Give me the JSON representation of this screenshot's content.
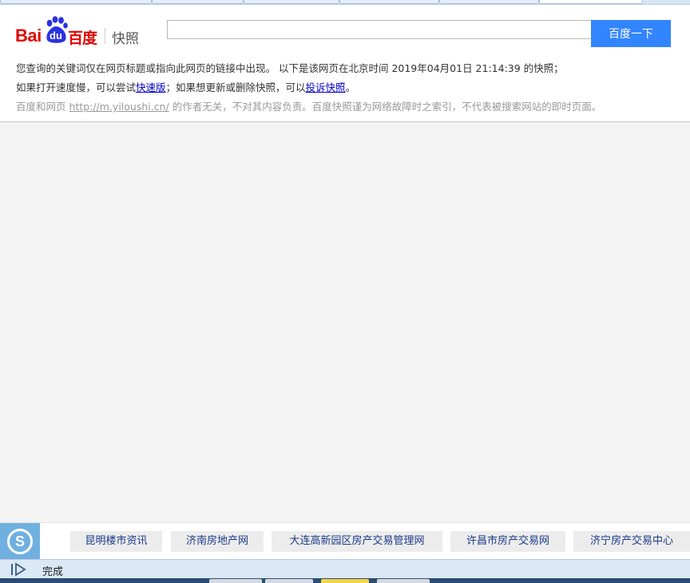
{
  "header": {
    "logo": {
      "text_bai": "Bai",
      "text_du": "du",
      "text_baidu": "百度",
      "text_kuaizhao": "快照"
    },
    "search": {
      "value": "",
      "button_label": "百度一下"
    }
  },
  "notice": {
    "line1": "您查询的关键词仅在网页标题或指向此网页的链接中出现。   以下是该网页在北京时间 2019年04月01日 21:14:39 的快照；",
    "line2_prefix": "如果打开速度慢，可以尝试",
    "line2_link1": "快速版",
    "line2_middle": "；如果想更新或删除快照，可以",
    "line2_link2": "投诉快照",
    "line2_suffix": "。",
    "line3_prefix": "百度和网页 ",
    "line3_link": "http://m.yiloushi.cn/",
    "line3_suffix": " 的作者无关，不对其内容负责。百度快照谨为网络故障时之索引，不代表被搜索网站的即时页面。"
  },
  "footer": {
    "sogou_icon": "sogou-s-icon",
    "links": [
      "昆明楼市资讯",
      "济南房地产网",
      "大连高新园区房产交易管理网",
      "许昌市房产交易网",
      "济宁房产交易中心"
    ]
  },
  "statusbar": {
    "icon": "page-status-icon",
    "text": "完成"
  },
  "colors": {
    "accent": "#3385ff",
    "brand_red": "#e10602",
    "brand_blue": "#2932e1",
    "link": "#0000cc",
    "footer_link": "#1a3a8a"
  }
}
